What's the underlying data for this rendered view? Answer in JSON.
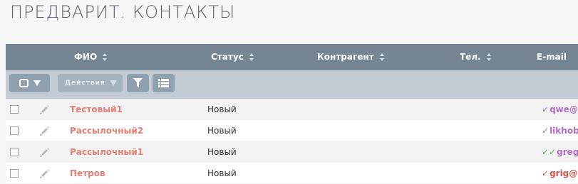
{
  "page": {
    "title": "ПРЕДВАРИТ. КОНТАКТЫ"
  },
  "table": {
    "columns": [
      {
        "label": "ФИО"
      },
      {
        "label": "Статус"
      },
      {
        "label": "Контрагент"
      },
      {
        "label": "Тел."
      },
      {
        "label": "E-mail"
      }
    ],
    "toolbar": {
      "actions_label": "Действия"
    },
    "rows": [
      {
        "name": "Тестовый1",
        "status": "Новый",
        "email_checks": "✓",
        "email": "qwe@a",
        "email_check_color": "#8e7ec8"
      },
      {
        "name": "Рассылочный2",
        "status": "Новый",
        "email_checks": "✓",
        "email": "likhobe",
        "email_check_color": "#8e7ec8"
      },
      {
        "name": "Рассылочный1",
        "status": "Новый",
        "email_checks": "✓✓",
        "email": "greg",
        "email_check_color": "#4caf50"
      },
      {
        "name": "Петров",
        "status": "Новый",
        "email_checks": "✓",
        "email": "grig@n",
        "email_check_color": "#d9534f"
      }
    ]
  },
  "icons": {
    "select": "checkbox-dropdown-icon",
    "filter": "filter-icon",
    "list": "list-icon",
    "edit": "pencil-icon"
  }
}
